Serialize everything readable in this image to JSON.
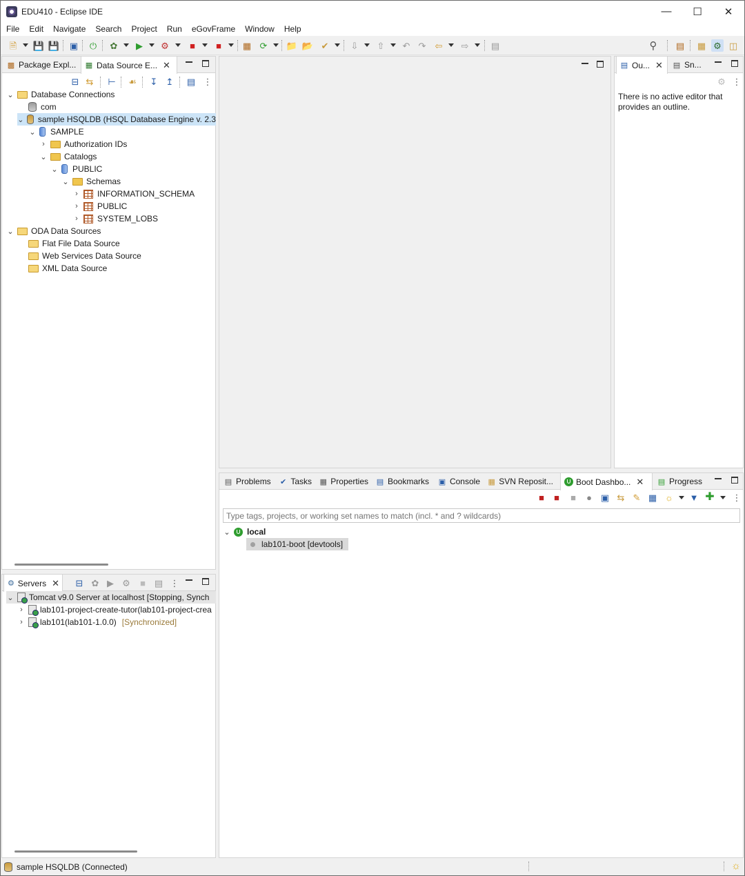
{
  "window": {
    "title": "EDU410 - Eclipse IDE"
  },
  "menu": [
    "File",
    "Edit",
    "Navigate",
    "Search",
    "Project",
    "Run",
    "eGovFrame",
    "Window",
    "Help"
  ],
  "left_panel": {
    "tabs": [
      {
        "label": "Package Expl..."
      },
      {
        "label": "Data Source E..."
      }
    ],
    "tree": {
      "database_connections": "Database Connections",
      "com": "com",
      "sample": "sample HSQLDB (HSQL Database Engine v. 2.3",
      "sample_db": "SAMPLE",
      "authorization_ids": "Authorization IDs",
      "catalogs": "Catalogs",
      "public_catalog": "PUBLIC",
      "schemas": "Schemas",
      "schema_information": "INFORMATION_SCHEMA",
      "schema_public": "PUBLIC",
      "schema_system_lobs": "SYSTEM_LOBS",
      "oda_data_sources": "ODA Data Sources",
      "flat_file": "Flat File Data Source",
      "web_services": "Web Services Data Source",
      "xml": "XML Data Source"
    }
  },
  "servers_panel": {
    "tab": "Servers",
    "server": "Tomcat v9.0 Server at localhost  [Stopping, Synch",
    "modules": [
      {
        "name": "lab101-project-create-tutor(lab101-project-crea",
        "status": ""
      },
      {
        "name": "lab101(lab101-1.0.0)",
        "status": "[Synchronized]"
      }
    ]
  },
  "outline_panel": {
    "tabs": [
      {
        "label": "Ou..."
      },
      {
        "label": "Sn..."
      }
    ],
    "message": "There is no active editor that provides an outline."
  },
  "bottom_panel": {
    "tabs": [
      {
        "label": "Problems"
      },
      {
        "label": "Tasks"
      },
      {
        "label": "Properties"
      },
      {
        "label": "Bookmarks"
      },
      {
        "label": "Console"
      },
      {
        "label": "SVN Reposit..."
      },
      {
        "label": "Boot Dashbo..."
      },
      {
        "label": "Progress"
      }
    ],
    "search_placeholder": "Type tags, projects, or working set names to match (incl. * and ? wildcards)",
    "local": "local",
    "app": "lab101-boot [devtools]"
  },
  "status": {
    "text": "sample HSQLDB (Connected)"
  }
}
